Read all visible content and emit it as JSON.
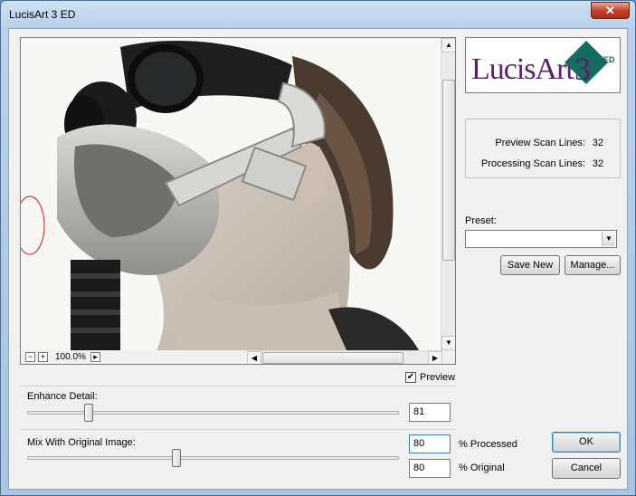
{
  "window": {
    "title": "LucisArt 3 ED",
    "close_glyph": "✕"
  },
  "image_view": {
    "zoom": "100.0%",
    "zoom_out_glyph": "−",
    "zoom_in_glyph": "+",
    "zoom_menu_glyph": "▸",
    "scroll_up_glyph": "▲",
    "scroll_down_glyph": "▼",
    "scroll_left_glyph": "◀",
    "scroll_right_glyph": "▶"
  },
  "logo": {
    "text": "LucisArt",
    "number": "3",
    "edition": "ED"
  },
  "scan_info": {
    "preview_label": "Preview Scan Lines:",
    "preview_value": "32",
    "processing_label": "Processing Scan Lines:",
    "processing_value": "32"
  },
  "preset": {
    "label": "Preset:",
    "selected": "",
    "arrow_glyph": "▼",
    "save_new_label": "Save New",
    "manage_label": "Manage..."
  },
  "preview": {
    "label": "Preview",
    "checked": true,
    "check_glyph": "✔"
  },
  "enhance_detail": {
    "label": "Enhance Detail:",
    "value": "81",
    "level": 0.81
  },
  "mix": {
    "label": "Mix With Original Image:",
    "processed_value": "80",
    "processed_label": "% Processed",
    "original_value": "80",
    "original_label": "% Original",
    "level": 0.8
  },
  "buttons": {
    "ok": "OK",
    "cancel": "Cancel"
  },
  "colors": {
    "logo_purple": "#5b1f67",
    "logo_teal": "#156b5e",
    "close_red": "#c7422b"
  }
}
